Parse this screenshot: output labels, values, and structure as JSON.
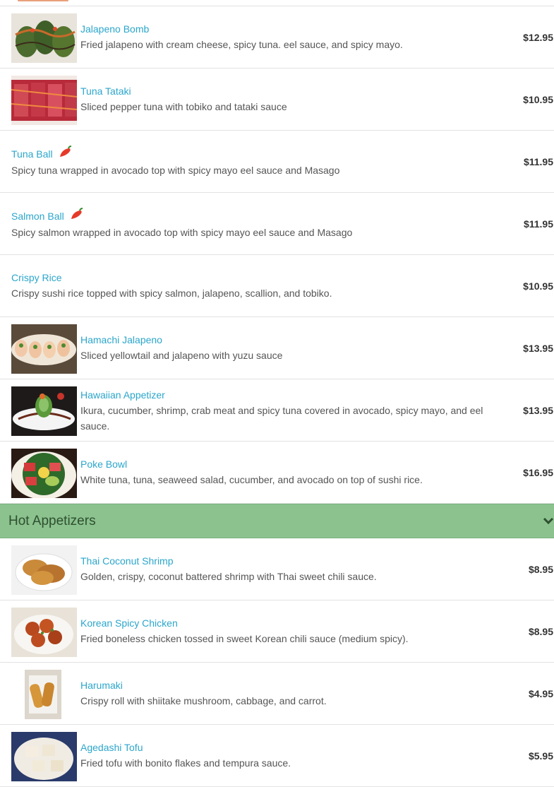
{
  "sections": [
    {
      "items": [
        {
          "name": "Jalapeno Bomb",
          "desc": "Fried jalapeno with cream cheese, spicy tuna. eel sauce, and spicy mayo.",
          "price": "$12.95",
          "icon": "jalapeno-bomb-photo"
        },
        {
          "name": "Tuna Tataki",
          "desc": "Sliced pepper tuna with tobiko and tataki sauce",
          "price": "$10.95",
          "icon": "tuna-tataki-photo"
        },
        {
          "name": "Tuna Ball",
          "desc": "Spicy tuna wrapped in avocado top with spicy mayo eel sauce and Masago",
          "price": "$11.95",
          "icon": "chili-pepper-icon"
        },
        {
          "name": "Salmon Ball",
          "desc": "Spicy salmon wrapped in avocado top with spicy mayo eel sauce and Masago",
          "price": "$11.95",
          "icon": "chili-pepper-icon"
        },
        {
          "name": "Crispy Rice",
          "desc": "Crispy sushi rice topped with spicy salmon, jalapeno, scallion, and tobiko.",
          "price": "$10.95"
        },
        {
          "name": "Hamachi Jalapeno",
          "desc": "Sliced yellowtail and jalapeno with yuzu sauce",
          "price": "$13.95",
          "icon": "hamachi-jalapeno-photo"
        },
        {
          "name": "Hawaiian Appetizer",
          "desc": "Ikura, cucumber, shrimp, crab meat and spicy tuna covered in avocado, spicy mayo, and eel sauce.",
          "price": "$13.95",
          "icon": "hawaiian-appetizer-photo"
        },
        {
          "name": "Poke Bowl",
          "desc": "White tuna, tuna, seaweed salad, cucumber, and avocado on top of sushi rice.",
          "price": "$16.95",
          "icon": "poke-bowl-photo"
        }
      ]
    },
    {
      "title": "Hot Appetizers",
      "items": [
        {
          "name": "Thai Coconut Shrimp",
          "desc": "Golden, crispy, coconut battered shrimp with Thai sweet chili sauce.",
          "price": "$8.95",
          "icon": "coconut-shrimp-photo"
        },
        {
          "name": "Korean Spicy Chicken",
          "desc": "Fried boneless chicken tossed in sweet Korean chili sauce (medium spicy).",
          "price": "$8.95",
          "icon": "korean-chicken-photo"
        },
        {
          "name": "Harumaki",
          "desc": "Crispy roll with shiitake mushroom, cabbage, and carrot.",
          "price": "$4.95",
          "icon": "harumaki-photo"
        },
        {
          "name": "Agedashi Tofu",
          "desc": "Fried tofu with bonito flakes and tempura sauce.",
          "price": "$5.95",
          "icon": "agedashi-tofu-photo"
        }
      ]
    }
  ],
  "colors": {
    "link": "#2ba6cb",
    "section_bg": "#8bc28e",
    "section_text": "#2f4f30"
  }
}
